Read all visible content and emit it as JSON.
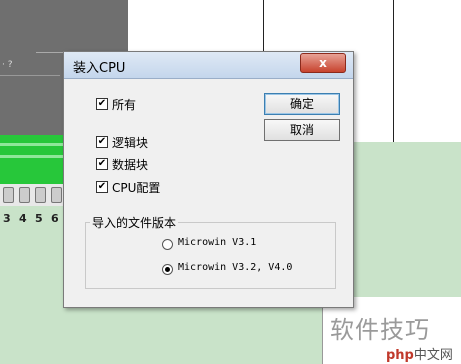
{
  "background": {
    "gray_label": "· ?",
    "terminal_numbers": [
      "3",
      "4",
      "5",
      "6"
    ],
    "watermark": "软件技巧",
    "logo_php": "php",
    "logo_rest": "中文网"
  },
  "dialog": {
    "title": "装入CPU",
    "close_label": "x",
    "checkboxes": [
      {
        "label": "所有",
        "checked": true
      },
      {
        "label": "逻辑块",
        "checked": true
      },
      {
        "label": "数据块",
        "checked": true
      },
      {
        "label": "CPU配置",
        "checked": true
      }
    ],
    "check_mark": "✔",
    "ok_label": "确定",
    "cancel_label": "取消",
    "group_title": "导入的文件版本",
    "radios": [
      {
        "label": "Microwin V3.1",
        "selected": false
      },
      {
        "label": "Microwin V3.2, V4.0",
        "selected": true
      }
    ]
  }
}
